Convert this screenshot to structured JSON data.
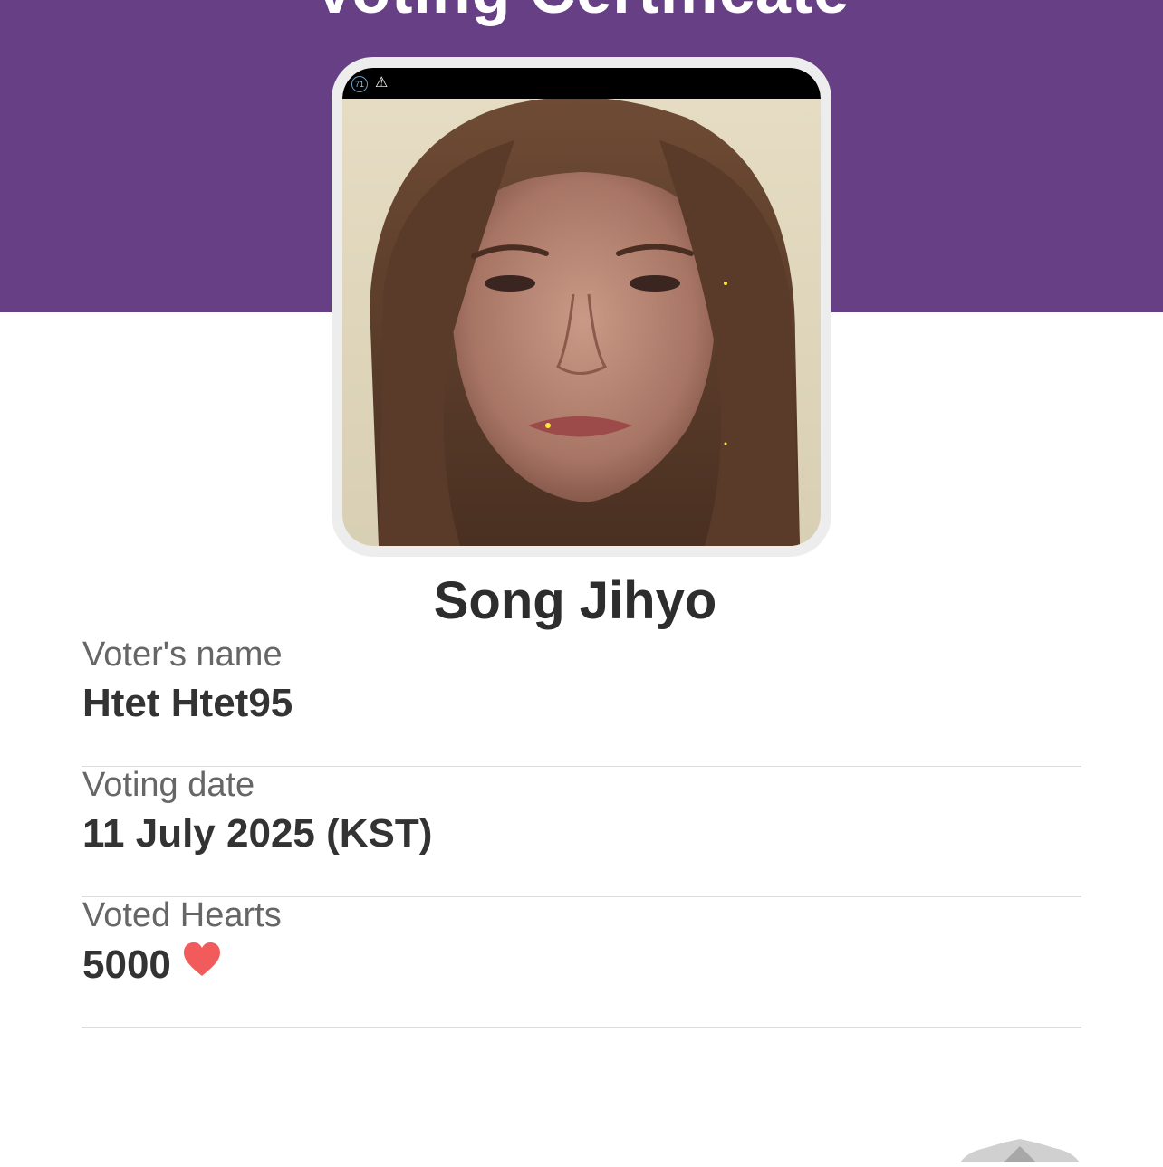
{
  "header": {
    "title": "Voting Certificate"
  },
  "photo": {
    "status_badge": "71",
    "status_icons": [
      "badge-icon",
      "warning-icon"
    ]
  },
  "idol": {
    "name": "Song Jihyo"
  },
  "fields": [
    {
      "label": "Voter's name",
      "value": "Htet Htet95"
    },
    {
      "label": "Voting date",
      "value": "11 July 2025 (KST)"
    },
    {
      "label": "Voted Hearts",
      "value": "5000",
      "icon": "heart-icon"
    }
  ],
  "colors": {
    "header_bg": "#663f84",
    "heart": "#f25b5b",
    "label": "#666666",
    "value": "#333333"
  },
  "decoration": {
    "icon": "seal-icon"
  }
}
